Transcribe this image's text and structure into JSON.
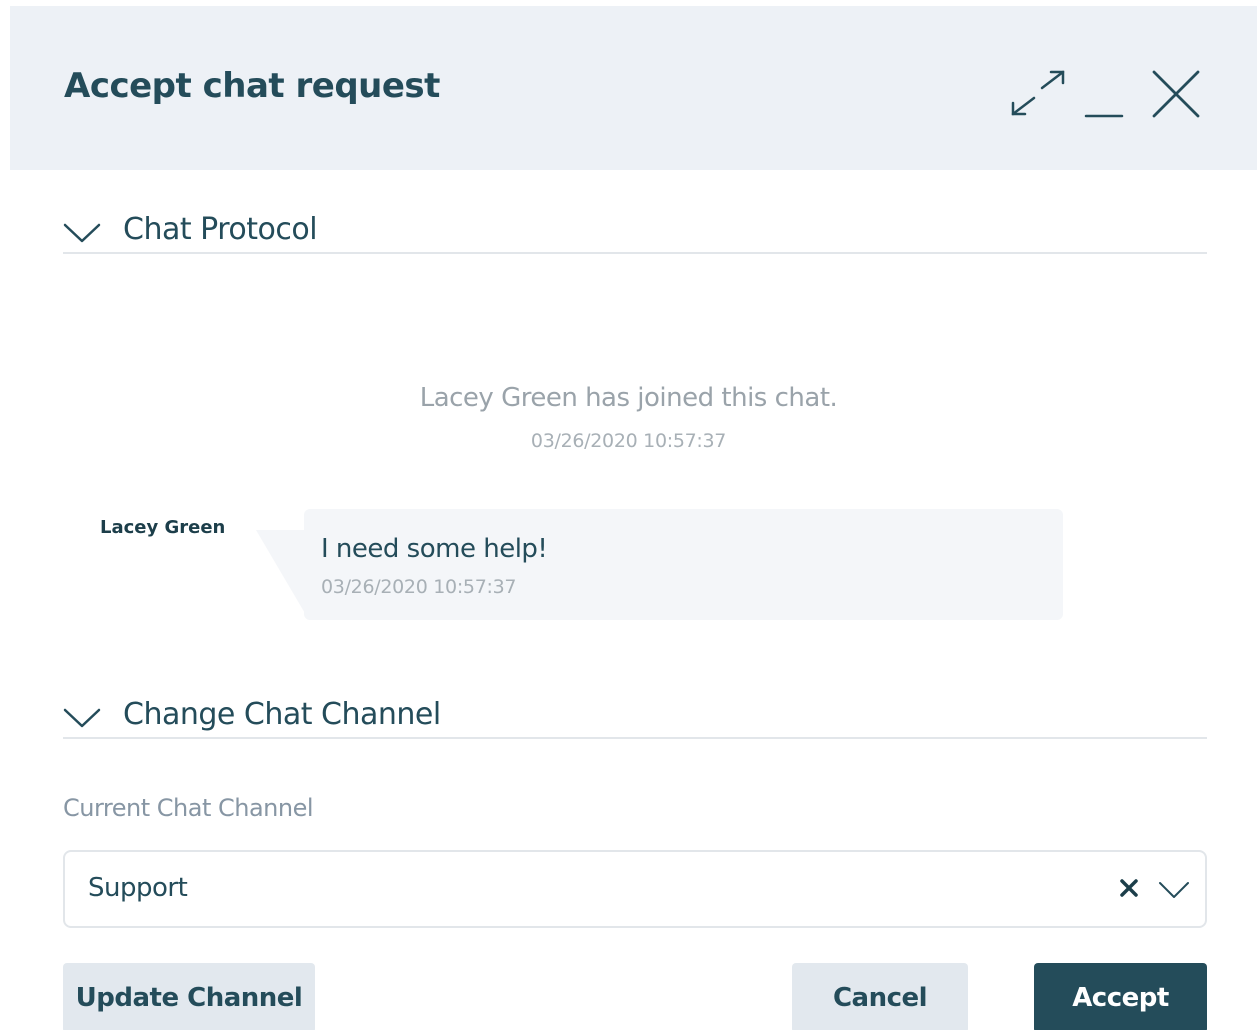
{
  "dialog": {
    "title": "Accept chat request",
    "controls": {
      "expand_icon": "expand-icon",
      "minimize_icon": "minimize-icon",
      "close_icon": "close-icon"
    }
  },
  "chat_protocol": {
    "section_label": "Chat Protocol",
    "system_message": {
      "text": "Lacey Green has joined this chat.",
      "timestamp": "03/26/2020 10:57:37"
    },
    "messages": [
      {
        "sender": "Lacey Green",
        "text": "I need some help!",
        "timestamp": "03/26/2020 10:57:37"
      }
    ]
  },
  "change_channel": {
    "section_label": "Change Chat Channel",
    "field_label": "Current Chat Channel",
    "selected_value": "Support"
  },
  "buttons": {
    "update": "Update Channel",
    "cancel": "Cancel",
    "accept": "Accept"
  },
  "colors": {
    "header_bg": "#edf1f6",
    "primary": "#244c5a",
    "secondary_button": "#e2e8ee",
    "bubble_bg": "#f4f6f9"
  }
}
